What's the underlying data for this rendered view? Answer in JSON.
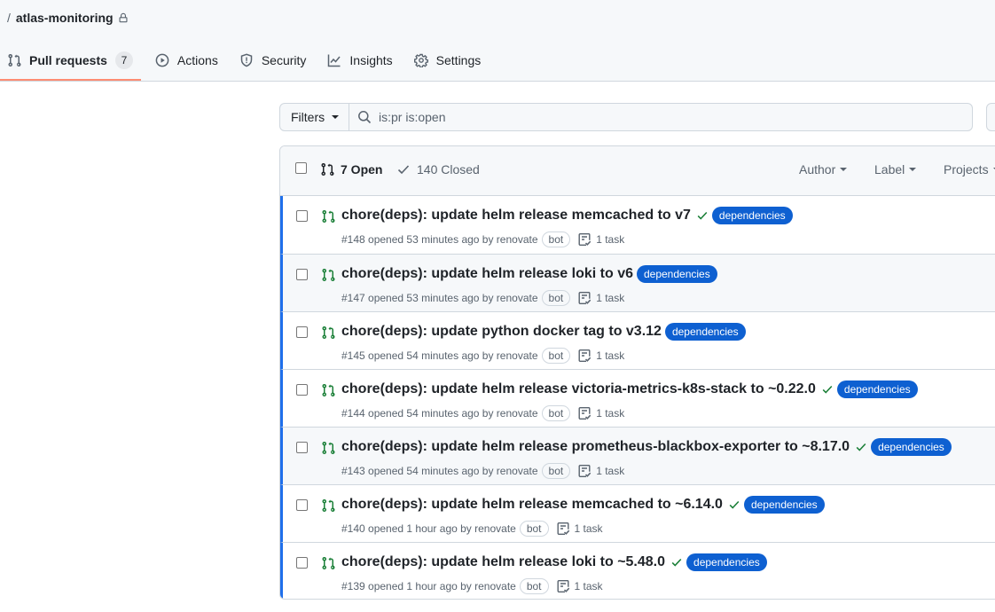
{
  "repo": {
    "separator": "/",
    "name": "atlas-monitoring"
  },
  "tabs": [
    {
      "label": "Pull requests",
      "count": "7"
    },
    {
      "label": "Actions"
    },
    {
      "label": "Security"
    },
    {
      "label": "Insights"
    },
    {
      "label": "Settings"
    }
  ],
  "filter_bar": {
    "filters_label": "Filters",
    "search_value": "is:pr is:open"
  },
  "list_header": {
    "open_label": "7 Open",
    "closed_label": "140 Closed",
    "filters": [
      "Author",
      "Label",
      "Projects"
    ]
  },
  "pull_requests": [
    {
      "title": "chore(deps): update helm release memcached to v7",
      "checks_passed": true,
      "label": "dependencies",
      "meta": "#148 opened 53 minutes ago by renovate",
      "bot": "bot",
      "tasks": "1 task"
    },
    {
      "title": "chore(deps): update helm release loki to v6",
      "checks_passed": false,
      "label": "dependencies",
      "meta": "#147 opened 53 minutes ago by renovate",
      "bot": "bot",
      "tasks": "1 task"
    },
    {
      "title": "chore(deps): update python docker tag to v3.12",
      "checks_passed": false,
      "label": "dependencies",
      "meta": "#145 opened 54 minutes ago by renovate",
      "bot": "bot",
      "tasks": "1 task"
    },
    {
      "title": "chore(deps): update helm release victoria-metrics-k8s-stack to ~0.22.0",
      "checks_passed": true,
      "label": "dependencies",
      "meta": "#144 opened 54 minutes ago by renovate",
      "bot": "bot",
      "tasks": "1 task"
    },
    {
      "title": "chore(deps): update helm release prometheus-blackbox-exporter to ~8.17.0",
      "checks_passed": true,
      "label": "dependencies",
      "meta": "#143 opened 54 minutes ago by renovate",
      "bot": "bot",
      "tasks": "1 task"
    },
    {
      "title": "chore(deps): update helm release memcached to ~6.14.0",
      "checks_passed": true,
      "label": "dependencies",
      "meta": "#140 opened 1 hour ago by renovate",
      "bot": "bot",
      "tasks": "1 task"
    },
    {
      "title": "chore(deps): update helm release loki to ~5.48.0",
      "checks_passed": true,
      "label": "dependencies",
      "meta": "#139 opened 1 hour ago by renovate",
      "bot": "bot",
      "tasks": "1 task"
    }
  ],
  "colors": {
    "label_bg": "#0e60d1",
    "open_icon": "#1a7f37",
    "selected_tab_underline": "#fd8c73"
  }
}
